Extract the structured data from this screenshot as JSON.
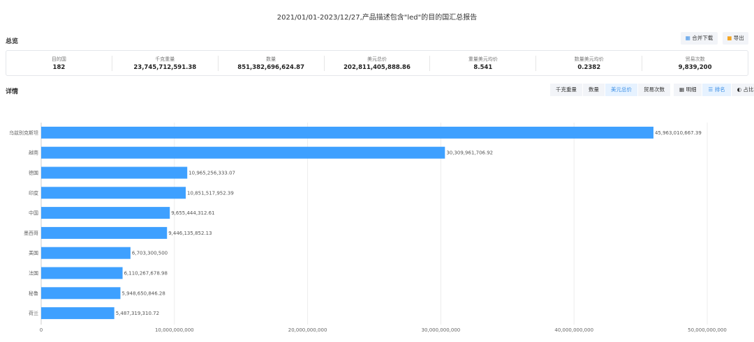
{
  "title": "2021/01/01-2023/12/27,产品描述包含\"led\"的目的国汇总报告",
  "overview_label": "总览",
  "detail_label": "详情",
  "buttons": {
    "merge_download": "合并下载",
    "export": "导出"
  },
  "summary": [
    {
      "label": "目的国",
      "value": "182"
    },
    {
      "label": "千克重量",
      "value": "23,745,712,591.38"
    },
    {
      "label": "数量",
      "value": "851,382,696,624.87"
    },
    {
      "label": "美元总价",
      "value": "202,811,405,888.86"
    },
    {
      "label": "重量美元均价",
      "value": "8.541"
    },
    {
      "label": "数量美元均价",
      "value": "0.2382"
    },
    {
      "label": "贸易次数",
      "value": "9,839,200"
    }
  ],
  "metric_tabs": [
    {
      "label": "千克重量",
      "active": false
    },
    {
      "label": "数量",
      "active": false
    },
    {
      "label": "美元总价",
      "active": true
    },
    {
      "label": "贸易次数",
      "active": false
    }
  ],
  "view_tabs": [
    {
      "label": "明细",
      "icon": "table-icon",
      "active": false
    },
    {
      "label": "排名",
      "icon": "ranking-icon",
      "active": true
    },
    {
      "label": "占比",
      "icon": "pie-icon",
      "active": false
    }
  ],
  "chart_data": {
    "type": "bar",
    "orientation": "horizontal",
    "categories": [
      "乌兹别克斯坦",
      "越南",
      "德国",
      "印度",
      "中国",
      "墨西哥",
      "美国",
      "法国",
      "秘鲁",
      "荷兰"
    ],
    "values": [
      45963010667.39,
      30309961706.92,
      10965256333.07,
      10851517952.39,
      9655444312.61,
      9446135852.13,
      6703300500,
      6110267678.98,
      5948650846.28,
      5487319310.72
    ],
    "value_labels": [
      "45,963,010,667.39",
      "30,309,961,706.92",
      "10,965,256,333.07",
      "10,851,517,952.39",
      "9,655,444,312.61",
      "9,446,135,852.13",
      "6,703,300,500",
      "6,110,267,678.98",
      "5,948,650,846.28",
      "5,487,319,310.72"
    ],
    "xlim": [
      0,
      50000000000
    ],
    "xticks": [
      0,
      10000000000,
      20000000000,
      30000000000,
      40000000000,
      50000000000
    ],
    "xtick_labels": [
      "0",
      "10,000,000,000",
      "20,000,000,000",
      "30,000,000,000",
      "40,000,000,000",
      "50,000,000,000"
    ],
    "grid": true,
    "bar_color": "#3ea0ff"
  }
}
